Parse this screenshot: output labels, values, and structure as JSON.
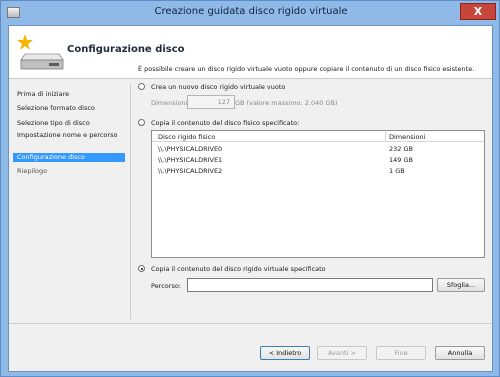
{
  "window": {
    "title": "Creazione guidata disco rigido virtuale",
    "close_symbol": "X",
    "app_icon": "hard-disk-icon"
  },
  "header": {
    "title": "Configurazione disco",
    "icon": "hard-disk-star-icon"
  },
  "nav": {
    "items": [
      {
        "label": "Prima di iniziare"
      },
      {
        "label": "Selezione formato disco"
      },
      {
        "label": "Selezione tipo di disco"
      },
      {
        "label": "Impostazione nome e percorso"
      },
      {
        "label": "Configurazione disco"
      },
      {
        "label": "Riepilogo"
      }
    ],
    "active_index": 4
  },
  "content": {
    "intro": "È possibile creare un disco rigido virtuale vuoto oppure copiare il contenuto di un disco fisico esistente.",
    "option_new": "Crea un nuovo disco rigido virtuale vuoto",
    "size_label": "Dimensioni:",
    "size_value": "127",
    "size_unit": "GB (valore massimo: 2.040 GB)",
    "option_physical": "Copia il contenuto del disco fisico specificato:",
    "table": {
      "headers": [
        "Disco rigido fisico",
        "Dimensioni"
      ],
      "rows": [
        [
          "\\\\.\\PHYSICALDRIVE0",
          "232 GB"
        ],
        [
          "\\\\.\\PHYSICALDRIVE1",
          "149 GB"
        ],
        [
          "\\\\.\\PHYSICALDRIVE2",
          "1 GB"
        ]
      ]
    },
    "option_virtual": "Copia il contenuto del disco rigido virtuale specificato",
    "path_label": "Percorso:",
    "path_value": "",
    "browse_label": "Sfoglia...",
    "selected_option": "option_virtual"
  },
  "footer": {
    "back": "< Indietro",
    "next": "Avanti >",
    "finish": "Fine",
    "cancel": "Annulla"
  }
}
